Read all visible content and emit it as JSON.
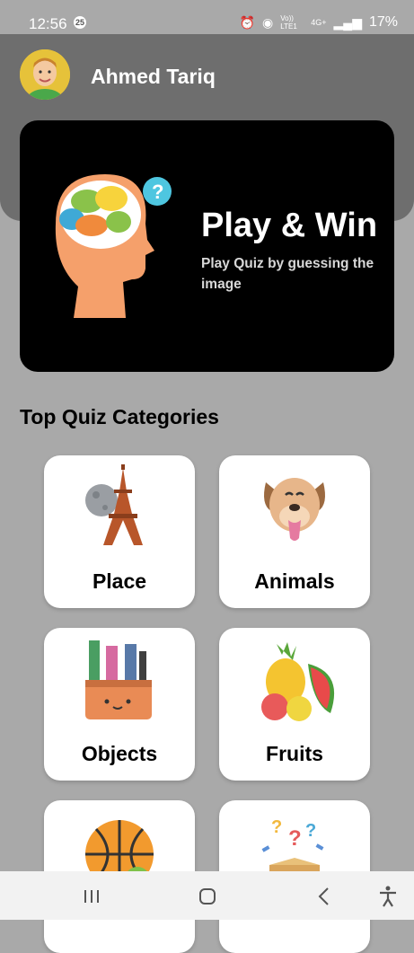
{
  "status_bar": {
    "time": "12:56",
    "notif_count": "25",
    "net_label": "Vo)) LTE1",
    "lte_label": "4G+",
    "battery": "17%"
  },
  "user": {
    "name": "Ahmed Tariq"
  },
  "hero": {
    "title": "Play & Win",
    "subtitle": "Play Quiz by guessing the image"
  },
  "section": {
    "title": "Top Quiz Categories"
  },
  "categories": [
    {
      "label": "Place",
      "icon": "eiffel-tower-icon"
    },
    {
      "label": "Animals",
      "icon": "dog-icon"
    },
    {
      "label": "Objects",
      "icon": "pencil-case-icon"
    },
    {
      "label": "Fruits",
      "icon": "fruits-icon"
    },
    {
      "label": "",
      "icon": "sports-balls-icon"
    },
    {
      "label": "",
      "icon": "mystery-box-icon"
    }
  ],
  "colors": {
    "background": "#a9a9a9",
    "header": "#6e6e6e",
    "hero": "#000000",
    "card": "#ffffff"
  }
}
